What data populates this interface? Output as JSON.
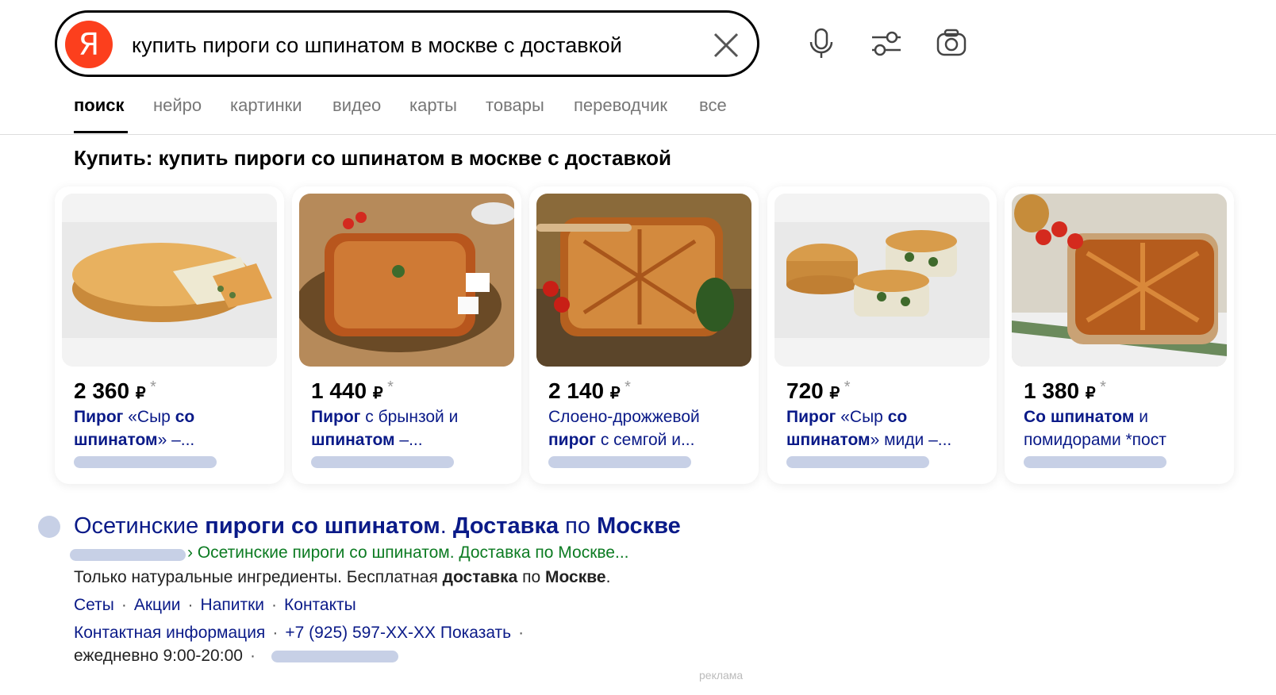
{
  "search": {
    "logo_letter": "Я",
    "query": "купить пироги со шпинатом в москве с доставкой"
  },
  "tabs": [
    {
      "label": "поиск",
      "active": true
    },
    {
      "label": "нейро",
      "active": false
    },
    {
      "label": "картинки",
      "active": false
    },
    {
      "label": "видео",
      "active": false
    },
    {
      "label": "карты",
      "active": false
    },
    {
      "label": "товары",
      "active": false
    },
    {
      "label": "переводчик",
      "active": false
    },
    {
      "label": "все",
      "active": false
    }
  ],
  "shopping": {
    "title": "Купить: купить пироги со шпинатом в москве с доставкой",
    "currency": "₽",
    "price_mark": "*",
    "cards": [
      {
        "price": "2 360",
        "title_bold_1": "Пирог",
        "title_mid_1": " «Сыр ",
        "title_bold_2": "со",
        "title_mid_2": " ",
        "title_bold_3": "шпинатом",
        "title_end": "» –...",
        "image": "round-pie-with-slice"
      },
      {
        "price": "1 440",
        "title_bold_1": "Пирог",
        "title_mid_1": " с брынзой и ",
        "title_bold_2": "",
        "title_mid_2": "",
        "title_bold_3": "шпинатом",
        "title_end": " –...",
        "image": "square-pie-on-mat"
      },
      {
        "price": "2 140",
        "title_bold_1": "",
        "title_mid_1": "Слоено-дрожжевой ",
        "title_bold_2": "",
        "title_mid_2": "",
        "title_bold_3": "пирог",
        "title_end": " с семгой и...",
        "image": "lattice-pie-with-spinach"
      },
      {
        "price": "720",
        "title_bold_1": "Пирог",
        "title_mid_1": " «Сыр ",
        "title_bold_2": "со",
        "title_mid_2": " ",
        "title_bold_3": "шпинатом",
        "title_end": "» миди –...",
        "image": "mini-pies-cut"
      },
      {
        "price": "1 380",
        "title_bold_1": "Со шпинатом",
        "title_mid_1": " и помидорами *пост",
        "title_bold_2": "",
        "title_mid_2": "",
        "title_bold_3": "",
        "title_end": "",
        "image": "lattice-pie-tomatoes"
      }
    ]
  },
  "result": {
    "title_parts": [
      {
        "text": "Осетинские ",
        "bold": false
      },
      {
        "text": "пироги со шпинатом",
        "bold": true
      },
      {
        "text": ". ",
        "bold": false
      },
      {
        "text": "Доставка",
        "bold": true
      },
      {
        "text": " по ",
        "bold": false
      },
      {
        "text": "Москве",
        "bold": true
      }
    ],
    "breadcrumb": "› Осетинские пироги со шпинатом. Доставка по Москве...",
    "snippet_parts": [
      {
        "text": "Только натуральные ингредиенты. Бесплатная ",
        "bold": false
      },
      {
        "text": "доставка",
        "bold": true
      },
      {
        "text": " по ",
        "bold": false
      },
      {
        "text": "Москве",
        "bold": true
      },
      {
        "text": ".",
        "bold": false
      }
    ],
    "sitelinks": [
      "Сеты",
      "Акции",
      "Напитки",
      "Контакты"
    ],
    "contact_info": "Контактная информация",
    "phone": "+7 (925) 597-XX-XX",
    "show_label": "Показать",
    "hours": "ежедневно 9:00-20:00",
    "separator": "·",
    "ad_label": "реклама"
  },
  "colors": {
    "logo": "#fc3f1d",
    "link": "#0a1a88",
    "url_green": "#0c7b22",
    "placeholder_pill": "#c7d0e6"
  }
}
